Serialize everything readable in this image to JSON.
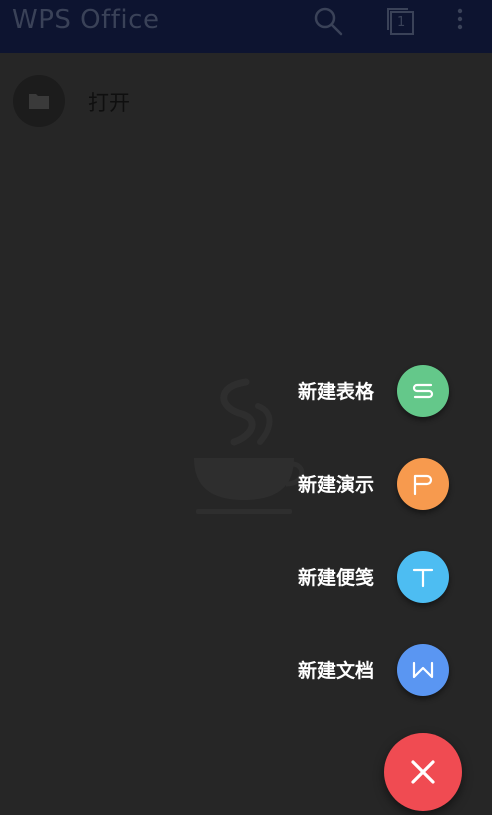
{
  "app_title": "WPS Office",
  "toolbar": {
    "search_icon": "search-icon",
    "tabs_count": "1",
    "more_icon": "more-vert-icon"
  },
  "open_item": {
    "label": "打开",
    "icon": "folder-icon"
  },
  "fab_menu": [
    {
      "label": "新建表格",
      "icon": "spreadsheet-icon",
      "color": "#64c88a"
    },
    {
      "label": "新建演示",
      "icon": "presentation-icon",
      "color": "#f79a4e"
    },
    {
      "label": "新建便笺",
      "icon": "note-icon",
      "color": "#4dbdf2"
    },
    {
      "label": "新建文档",
      "icon": "document-icon",
      "color": "#5a96f2"
    }
  ],
  "fab_close": {
    "icon": "close-icon",
    "color": "#f04b52"
  }
}
